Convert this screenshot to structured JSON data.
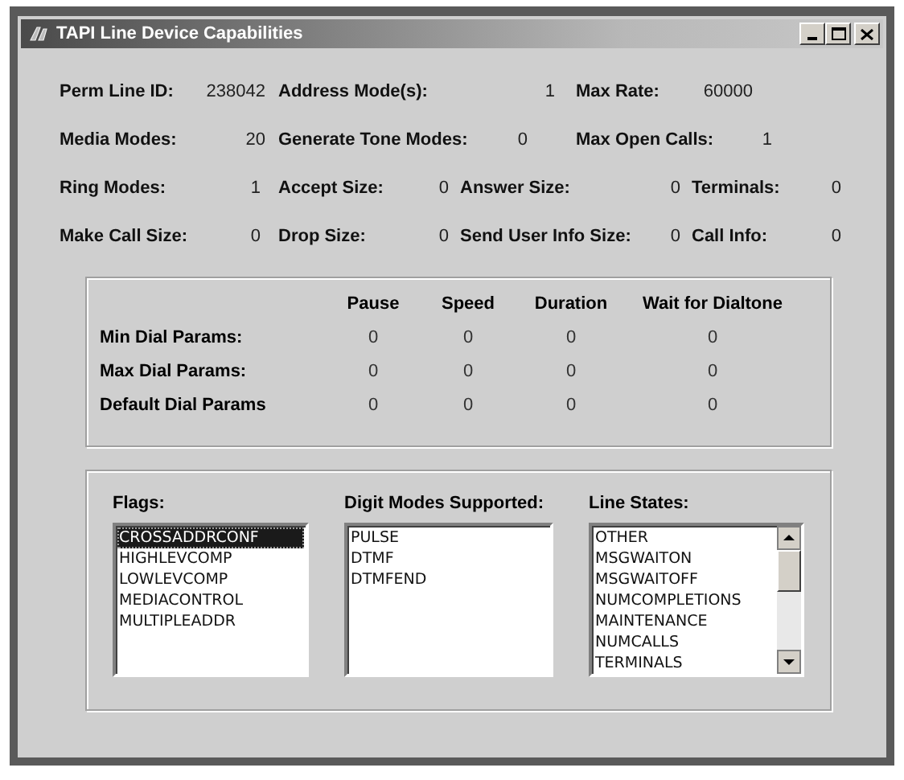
{
  "window": {
    "title": "TAPI Line Device Capabilities"
  },
  "fields": [
    [
      {
        "label": "Perm Line ID:",
        "value": "238042"
      },
      {
        "label": "Address Mode(s):",
        "value": "1"
      },
      {
        "label": "Max Rate:",
        "value": "60000"
      }
    ],
    [
      {
        "label": "Media Modes:",
        "value": "20"
      },
      {
        "label": "Generate Tone Modes:",
        "value": "0"
      },
      {
        "label": "Max Open Calls:",
        "value": "1"
      }
    ],
    [
      {
        "label": "Ring Modes:",
        "value": "1"
      },
      {
        "label": "Accept Size:",
        "value": "0"
      },
      {
        "label": "Answer Size:",
        "value": "0"
      },
      {
        "label": "Terminals:",
        "value": "0"
      }
    ],
    [
      {
        "label": "Make Call Size:",
        "value": "0"
      },
      {
        "label": "Drop Size:",
        "value": "0"
      },
      {
        "label": "Send User Info Size:",
        "value": "0"
      },
      {
        "label": "Call Info:",
        "value": "0"
      }
    ]
  ],
  "dial_params": {
    "columns": [
      "Pause",
      "Speed",
      "Duration",
      "Wait for Dialtone"
    ],
    "rows": [
      {
        "label": "Min Dial Params:",
        "values": [
          "0",
          "0",
          "0",
          "0"
        ]
      },
      {
        "label": "Max Dial Params:",
        "values": [
          "0",
          "0",
          "0",
          "0"
        ]
      },
      {
        "label": "Default Dial Params",
        "values": [
          "0",
          "0",
          "0",
          "0"
        ]
      }
    ]
  },
  "lists": [
    {
      "label": "Flags:",
      "items": [
        {
          "text": "CROSSADDRCONF",
          "selected": true
        },
        {
          "text": "HIGHLEVCOMP",
          "selected": false
        },
        {
          "text": "LOWLEVCOMP",
          "selected": false
        },
        {
          "text": "MEDIACONTROL",
          "selected": false
        },
        {
          "text": "MULTIPLEADDR",
          "selected": false
        }
      ]
    },
    {
      "label": "Digit Modes Supported:",
      "items": [
        {
          "text": "PULSE",
          "selected": false
        },
        {
          "text": "DTMF",
          "selected": false
        },
        {
          "text": "DTMFEND",
          "selected": false
        }
      ]
    },
    {
      "label": "Line States:",
      "scrollbar": true,
      "items": [
        {
          "text": "OTHER",
          "selected": false
        },
        {
          "text": "MSGWAITON",
          "selected": false
        },
        {
          "text": "MSGWAITOFF",
          "selected": false
        },
        {
          "text": "NUMCOMPLETIONS",
          "selected": false
        },
        {
          "text": "MAINTENANCE",
          "selected": false
        },
        {
          "text": "NUMCALLS",
          "selected": false
        },
        {
          "text": "TERMINALS",
          "selected": false
        }
      ]
    }
  ]
}
